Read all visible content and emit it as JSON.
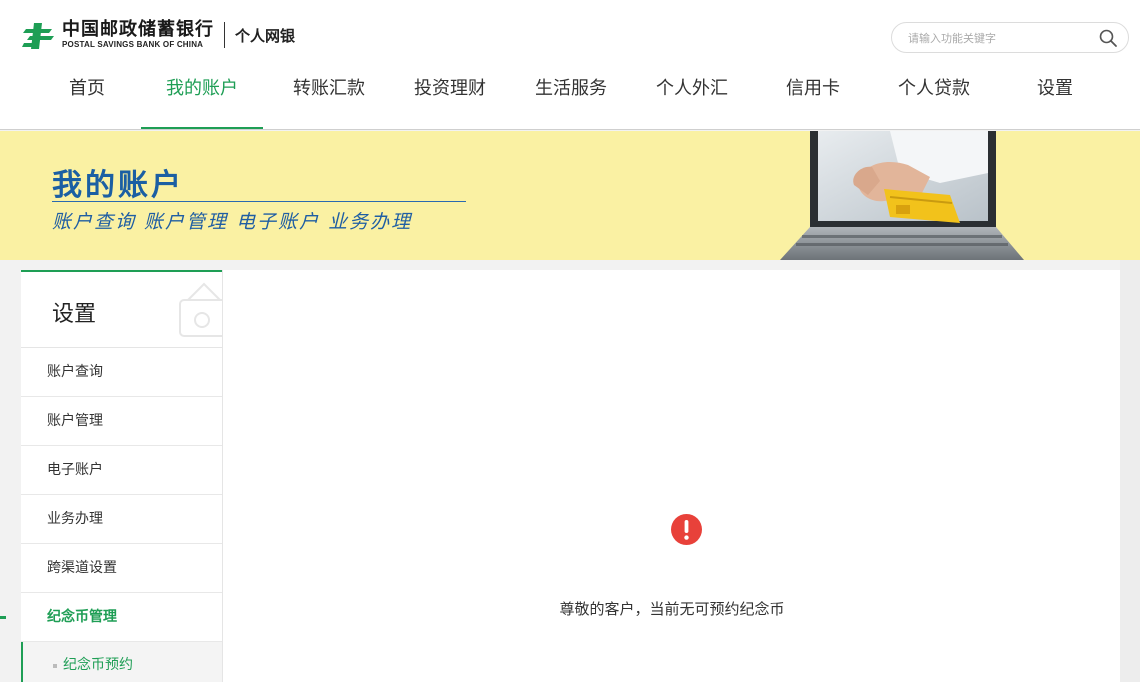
{
  "header": {
    "bank_name_cn": "中国邮政储蓄银行",
    "bank_name_en": "POSTAL SAVINGS BANK OF CHINA",
    "subtitle": "个人网银",
    "brand_color": "#1e9e55",
    "search": {
      "placeholder": "请输入功能关键字",
      "value": "",
      "icon": "search-icon"
    }
  },
  "nav": {
    "items": [
      {
        "label": "首页",
        "active": false
      },
      {
        "label": "我的账户",
        "active": true
      },
      {
        "label": "转账汇款",
        "active": false
      },
      {
        "label": "投资理财",
        "active": false
      },
      {
        "label": "生活服务",
        "active": false
      },
      {
        "label": "个人外汇",
        "active": false
      },
      {
        "label": "信用卡",
        "active": false
      },
      {
        "label": "个人贷款",
        "active": false
      },
      {
        "label": "设置",
        "active": false
      }
    ]
  },
  "banner": {
    "title": "我的账户",
    "subtitle": "账户查询 账户管理 电子账户 业务办理",
    "background_color": "#faf1a3",
    "title_color": "#1b5fa3"
  },
  "sidebar": {
    "title": "设置",
    "items": [
      {
        "label": "账户查询",
        "active": false
      },
      {
        "label": "账户管理",
        "active": false
      },
      {
        "label": "电子账户",
        "active": false
      },
      {
        "label": "业务办理",
        "active": false
      },
      {
        "label": "跨渠道设置",
        "active": false
      },
      {
        "label": "纪念币管理",
        "active": true
      }
    ],
    "sub_items": [
      {
        "label": "纪念币预约",
        "active": true
      }
    ]
  },
  "main": {
    "alert_icon": "exclamation-circle-icon",
    "alert_color": "#e8413a",
    "message": "尊敬的客户，当前无可预约纪念币"
  }
}
